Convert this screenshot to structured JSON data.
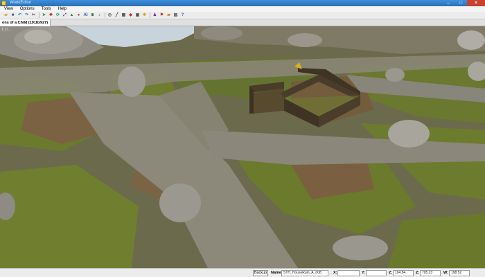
{
  "window": {
    "title": "WorldEditor"
  },
  "menu": {
    "items": [
      "View",
      "Options",
      "Tools",
      "Help"
    ]
  },
  "toolbar": {
    "icons": [
      "open-icon",
      "save-icon",
      "undo-icon",
      "redo-icon",
      "cut-icon",
      "select-icon",
      "move-icon",
      "rotate-icon",
      "scale-icon",
      "terrain-icon",
      "paint-icon",
      "ai-icon",
      "waypoint-icon",
      "sound-icon",
      "object-icon",
      "brush-icon",
      "grid-icon",
      "snap-icon",
      "camera-icon",
      "light-icon",
      "npc-icon",
      "trigger-icon",
      "item-icon",
      "map-icon",
      "help-icon"
    ]
  },
  "document": {
    "tab_label": "ons of a Child (1918x927)"
  },
  "viewport": {
    "fps_text": "1:17..."
  },
  "statusbar": {
    "backup_label": "Backup",
    "name_label": "Name:",
    "name_value": "STH_HouseRuin_A_008",
    "x_label": "X:",
    "x_value": "",
    "y_label": "Y:",
    "y_value": "",
    "z_label": "Z:",
    "z_value": "104.84",
    "rot_label": "Z:",
    "rot_value": "705.23",
    "w_label": "W:",
    "w_value": "198.52"
  },
  "colors": {
    "grass": "#6f7d2e",
    "cobble": "#8a8778",
    "dirt": "#7a6242",
    "rock": "#9a9790",
    "water": "#c9d6df",
    "ruin": "#4a3c2a"
  }
}
